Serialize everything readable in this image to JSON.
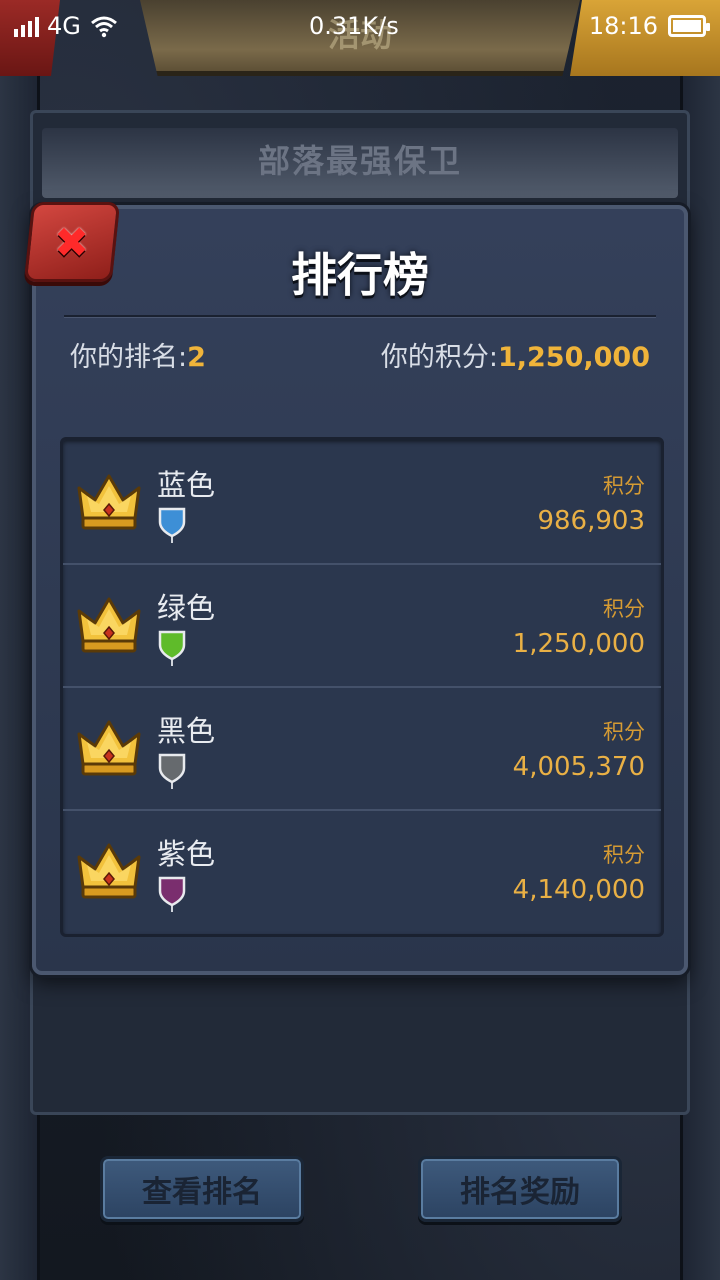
{
  "status_bar": {
    "network": "4G",
    "speed": "0.31K/s",
    "time": "18:16"
  },
  "background": {
    "banner_title": "活动",
    "event_title": "部落最强保卫"
  },
  "dialog": {
    "title": "排行榜",
    "close_label": "✖",
    "my_rank_label": "你的排名:",
    "my_rank_value": "2",
    "my_score_label": "你的积分:",
    "my_score_value": "1,250,000"
  },
  "teams": [
    {
      "name": "蓝色",
      "score_label": "积分",
      "score": "986,903",
      "flag_color": "#3d8fd6"
    },
    {
      "name": "绿色",
      "score_label": "积分",
      "score": "1,250,000",
      "flag_color": "#5fbb2a"
    },
    {
      "name": "黑色",
      "score_label": "积分",
      "score": "4,005,370",
      "flag_color": "#666a6e"
    },
    {
      "name": "紫色",
      "score_label": "积分",
      "score": "4,140,000",
      "flag_color": "#7a2e6e"
    }
  ],
  "buttons": {
    "view_rank": "查看排名",
    "rank_reward": "排名奖励"
  },
  "icons": {
    "crown": "crown-icon",
    "flag": "flag-icon",
    "close": "close-icon",
    "wifi": "wifi-icon",
    "signal": "signal-icon",
    "battery": "battery-icon"
  }
}
